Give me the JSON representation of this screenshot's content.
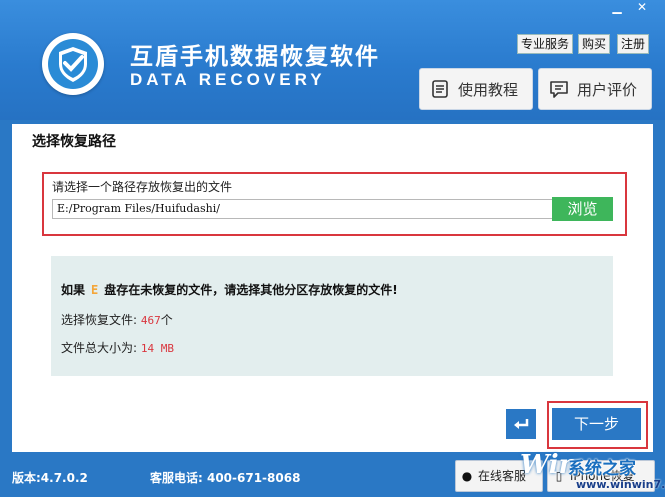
{
  "window": {
    "minimize_glyph": "▁",
    "close_glyph": "✕"
  },
  "header": {
    "title": "互盾手机数据恢复软件",
    "subtitle": "DATA RECOVERY",
    "links": [
      "专业服务",
      "购买",
      "注册"
    ],
    "tutorial_label": "使用教程",
    "review_label": "用户评价"
  },
  "main": {
    "section_title": "选择恢复路径",
    "path_label": "请选择一个路径存放恢复出的文件",
    "path_value": "E:/Program Files/Huifudashi/",
    "browse_label": "浏览",
    "info": {
      "warning_prefix": "如果",
      "drive": "E",
      "warning_suffix": "盘存在未恢复的文件，请选择其他分区存放恢复的文件!",
      "files_label": "选择恢复文件:",
      "files_count": "467",
      "files_unit": "个",
      "size_label": "文件总大小为:",
      "size_value": "14 MB"
    },
    "back_glyph": "↩",
    "next_label": "下一步"
  },
  "footer": {
    "version": "版本:4.7.0.2",
    "phone": "客服电话: 400-671-8068",
    "online_service_label": "在线客服",
    "iphone_restore_label": "iPhone恢复"
  },
  "watermark": {
    "logo": "Win",
    "text": "系统之家",
    "url": "www.winwin7.com"
  },
  "colors": {
    "brand_blue": "#2a78c5",
    "accent_green": "#3eb65b",
    "highlight_red": "#d9363e"
  }
}
